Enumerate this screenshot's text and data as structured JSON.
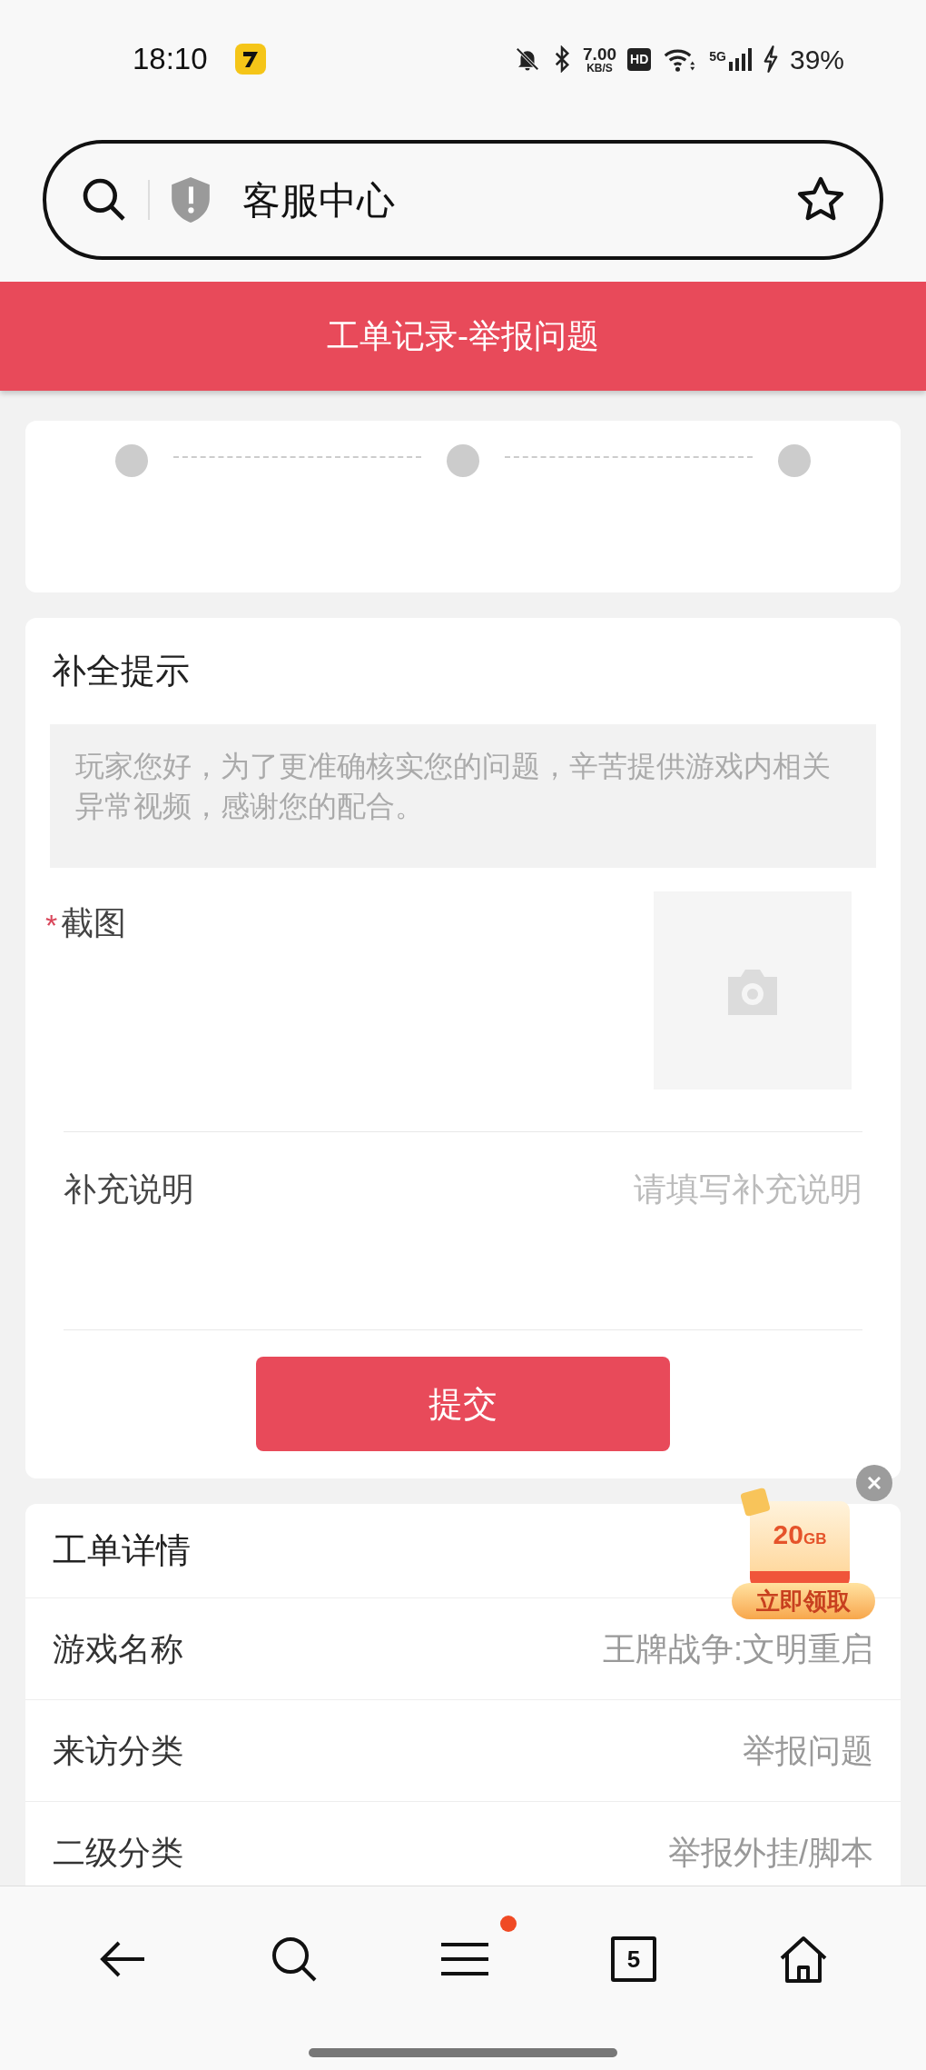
{
  "status_bar": {
    "time": "18:10",
    "speed_value": "7.00",
    "speed_unit": "KB/S",
    "hd": "HD",
    "network": "5G",
    "battery": "39%"
  },
  "address_bar": {
    "title": "客服中心",
    "starred": false
  },
  "header": {
    "title": "工单记录-举报问题"
  },
  "steps": [
    {
      "done": false
    },
    {
      "done": false
    },
    {
      "done": false
    }
  ],
  "supplement": {
    "title": "补全提示",
    "notice": "玩家您好，为了更准确核实您的问题，辛苦提供游戏内相关异常视频，感谢您的配合。",
    "screenshot_label": "截图",
    "required_mark": "*",
    "note_label": "补充说明",
    "note_placeholder": "请填写补充说明",
    "submit": "提交"
  },
  "details": {
    "title": "工单详情",
    "rows": [
      {
        "label": "游戏名称",
        "value": "王牌战争:文明重启"
      },
      {
        "label": "来访分类",
        "value": "举报问题"
      },
      {
        "label": "二级分类",
        "value": "举报外挂/脚本"
      }
    ]
  },
  "promo": {
    "amount": "20",
    "unit": "GB",
    "action": "立即领取"
  },
  "bottom_nav": {
    "tabs_count": "5",
    "menu_badge": true
  }
}
